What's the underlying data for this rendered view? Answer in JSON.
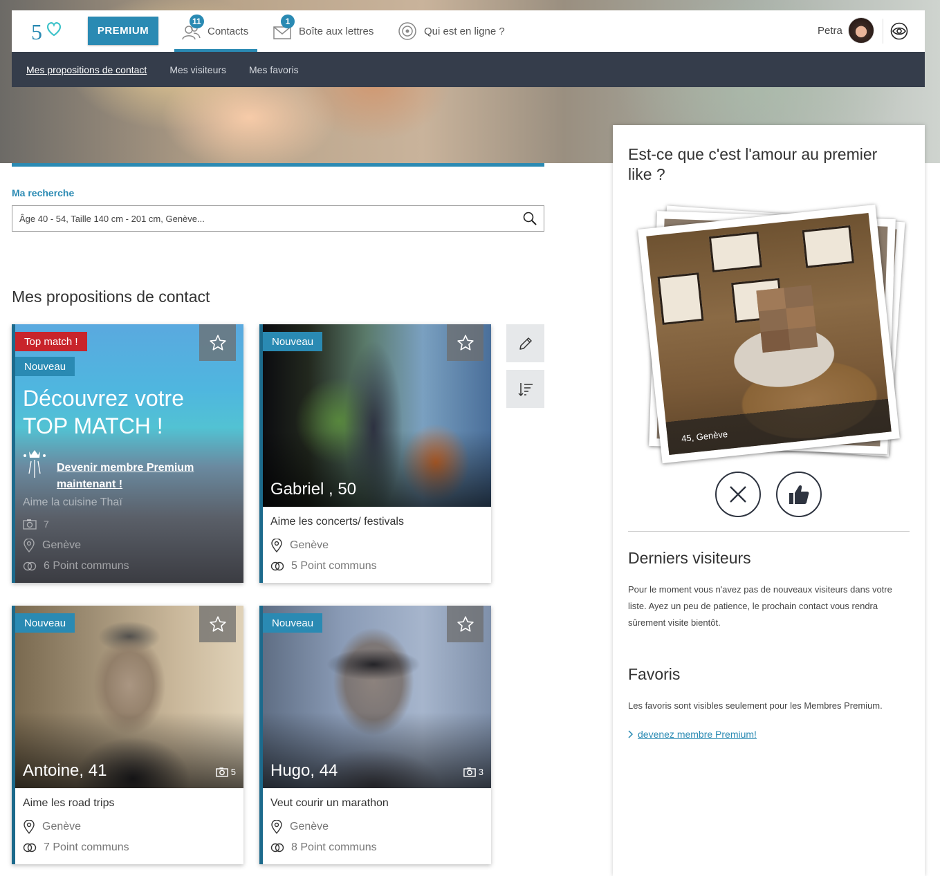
{
  "nav": {
    "premium_label": "PREMIUM",
    "contacts_label": "Contacts",
    "contacts_badge": "11",
    "mailbox_label": "Boîte aux lettres",
    "mailbox_badge": "1",
    "online_label": "Qui est en ligne ?",
    "user_name": "Petra"
  },
  "subnav": {
    "items": [
      "Mes propositions de contact",
      "Mes visiteurs",
      "Mes favoris"
    ]
  },
  "search": {
    "label": "Ma recherche",
    "value": "Âge 40 - 54, Taille 140 cm - 201 cm, Genève..."
  },
  "section_title": "Mes propositions de contact",
  "top_match_card": {
    "tag_top": "Top match !",
    "tag_new": "Nouveau",
    "headline_line1": "Découvrez votre",
    "headline_line2": "TOP MATCH !",
    "premium_link_line1": "Devenir membre Premium",
    "premium_link_line2": "maintenant !",
    "interest": "Aime la cuisine Thaï",
    "photos": "7",
    "city": "Genève",
    "common": "6 Point communs"
  },
  "cards": [
    {
      "tag": "Nouveau",
      "name": "Gabriel , 50",
      "photos": "",
      "desc": "Aime les concerts/ festivals",
      "city": "Genève",
      "common": "5 Point communs"
    },
    {
      "tag": "Nouveau",
      "name": "Antoine, 41",
      "photos": "5",
      "desc": "Aime les road trips",
      "city": "Genève",
      "common": "7 Point communs"
    },
    {
      "tag": "Nouveau",
      "name": "Hugo, 44",
      "photos": "3",
      "desc": "Veut courir un marathon",
      "city": "Genève",
      "common": "8 Point communs"
    }
  ],
  "panel": {
    "like_title": "Est-ce que c'est l'amour au premier like ?",
    "like_caption": "45, Genève",
    "visitors_title": "Derniers visiteurs",
    "visitors_text": "Pour le moment vous n'avez pas de nouveaux visiteurs dans votre liste. Ayez un peu de patience, le prochain contact vous rendra sûrement visite bientôt.",
    "favorites_title": "Favoris",
    "favorites_text": "Les favoris sont visibles seulement pour les Membres Premium.",
    "favorites_link": "devenez membre Premium!"
  },
  "colors": {
    "accent": "#2a8ab3",
    "subnav_bg": "#353d4b",
    "top_match_red": "#c8242b"
  }
}
